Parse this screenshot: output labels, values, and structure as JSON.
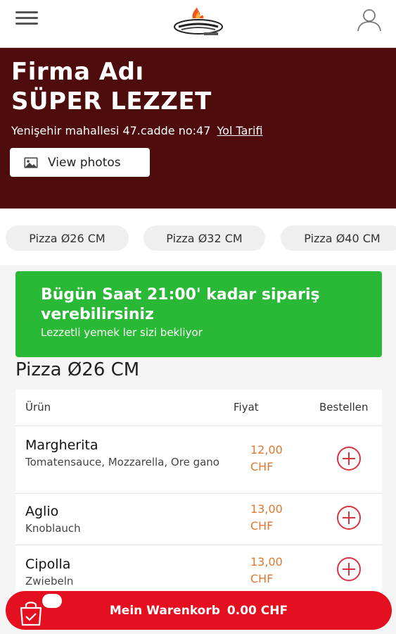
{
  "header": {
    "logo_alt": "logo",
    "icons": {
      "menu": "hamburger-menu-icon",
      "user": "user-profile-icon"
    }
  },
  "hero": {
    "firm_label": "Firma Adı",
    "firm_name": "SÜPER LEZZET",
    "address": "Yenişehir mahallesi 47.cadde no:47",
    "directions_link": "Yol Tarifi",
    "photos_button": "View photos",
    "background_color": "#4f0c0c"
  },
  "categories": [
    {
      "label": "Pizza Ø26 CM"
    },
    {
      "label": "Pizza Ø32 CM"
    },
    {
      "label": "Pizza Ø40 CM"
    }
  ],
  "notice": {
    "title": "Bügün Saat 21:00' kadar sipariş verebilirsiniz",
    "subtitle": "Lezzetli yemek ler sizi bekliyor",
    "color": "#2ab936"
  },
  "section": {
    "title": "Pizza Ø26 CM"
  },
  "table": {
    "columns": {
      "product": "Ürün",
      "price": "Fiyat",
      "order": "Bestellen"
    },
    "rows": [
      {
        "name": "Margherita",
        "description": "Tomatensauce, Mozzarella, Ore gano",
        "price": "12,00",
        "currency": "CHF"
      },
      {
        "name": "Aglio",
        "description": "Knoblauch",
        "price": "13,00",
        "currency": "CHF"
      },
      {
        "name": "Cipolla",
        "description": "Zwiebeln",
        "price": "13,00",
        "currency": "CHF"
      }
    ],
    "price_color": "#e0782f",
    "add_icon": "plus-circle-icon"
  },
  "cart": {
    "label": "Mein Warenkorb",
    "total": "0.00 CHF",
    "color": "#e5101f",
    "icon": "shopping-bag-icon"
  }
}
